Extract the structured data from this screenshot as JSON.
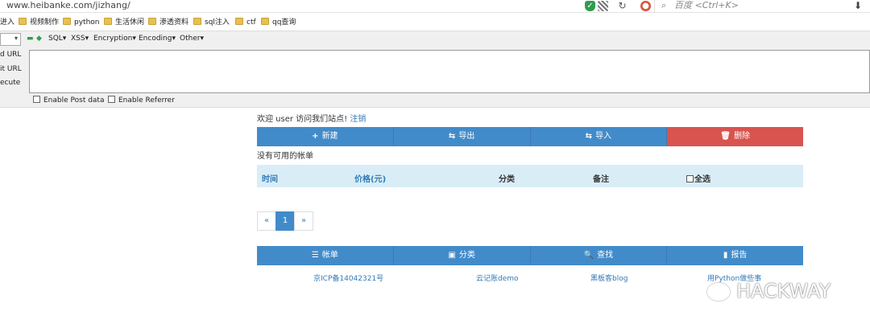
{
  "browser": {
    "url": "www.heibanke.com/jizhang/",
    "search_placeholder": "百度 <Ctrl+K>"
  },
  "bookmarks": [
    "进入",
    "视频制作",
    "python",
    "生活休闲",
    "渗透资料",
    "sql注入",
    "ctf",
    "qq查询"
  ],
  "hackbar": {
    "menus": [
      "SQL▾",
      "XSS▾",
      "Encryption▾",
      "Encoding▾",
      "Other▾"
    ],
    "side_labels": [
      "d URL",
      "it URL",
      "ecute"
    ],
    "checkboxes": [
      "Enable Post data",
      "Enable Referrer"
    ]
  },
  "page": {
    "welcome": "欢迎 user 访问我们站点!",
    "logout": "注销",
    "actions": [
      {
        "label": "新建",
        "icon": "+"
      },
      {
        "label": "导出",
        "icon": "⇆"
      },
      {
        "label": "导入",
        "icon": "⇆"
      },
      {
        "label": "删除",
        "icon": "🗑"
      }
    ],
    "empty_message": "没有可用的帐单",
    "table_headers": [
      "时间",
      "价格(元)",
      "分类",
      "备注",
      "全选"
    ],
    "pager": [
      "«",
      "1",
      "»"
    ],
    "nav": [
      {
        "label": "帐单",
        "icon": "☰"
      },
      {
        "label": "分类",
        "icon": "▣"
      },
      {
        "label": "查找",
        "icon": "🔍"
      },
      {
        "label": "报告",
        "icon": "▮"
      }
    ],
    "footer_links": [
      "京ICP备14042321号",
      "云记账demo",
      "黑板客blog",
      "用Python做些事"
    ]
  },
  "watermark": "HACKWAY",
  "colors": {
    "primary": "#428bca",
    "danger": "#d9534f",
    "link": "#337ab7",
    "table_head_bg": "#d9edf7"
  }
}
